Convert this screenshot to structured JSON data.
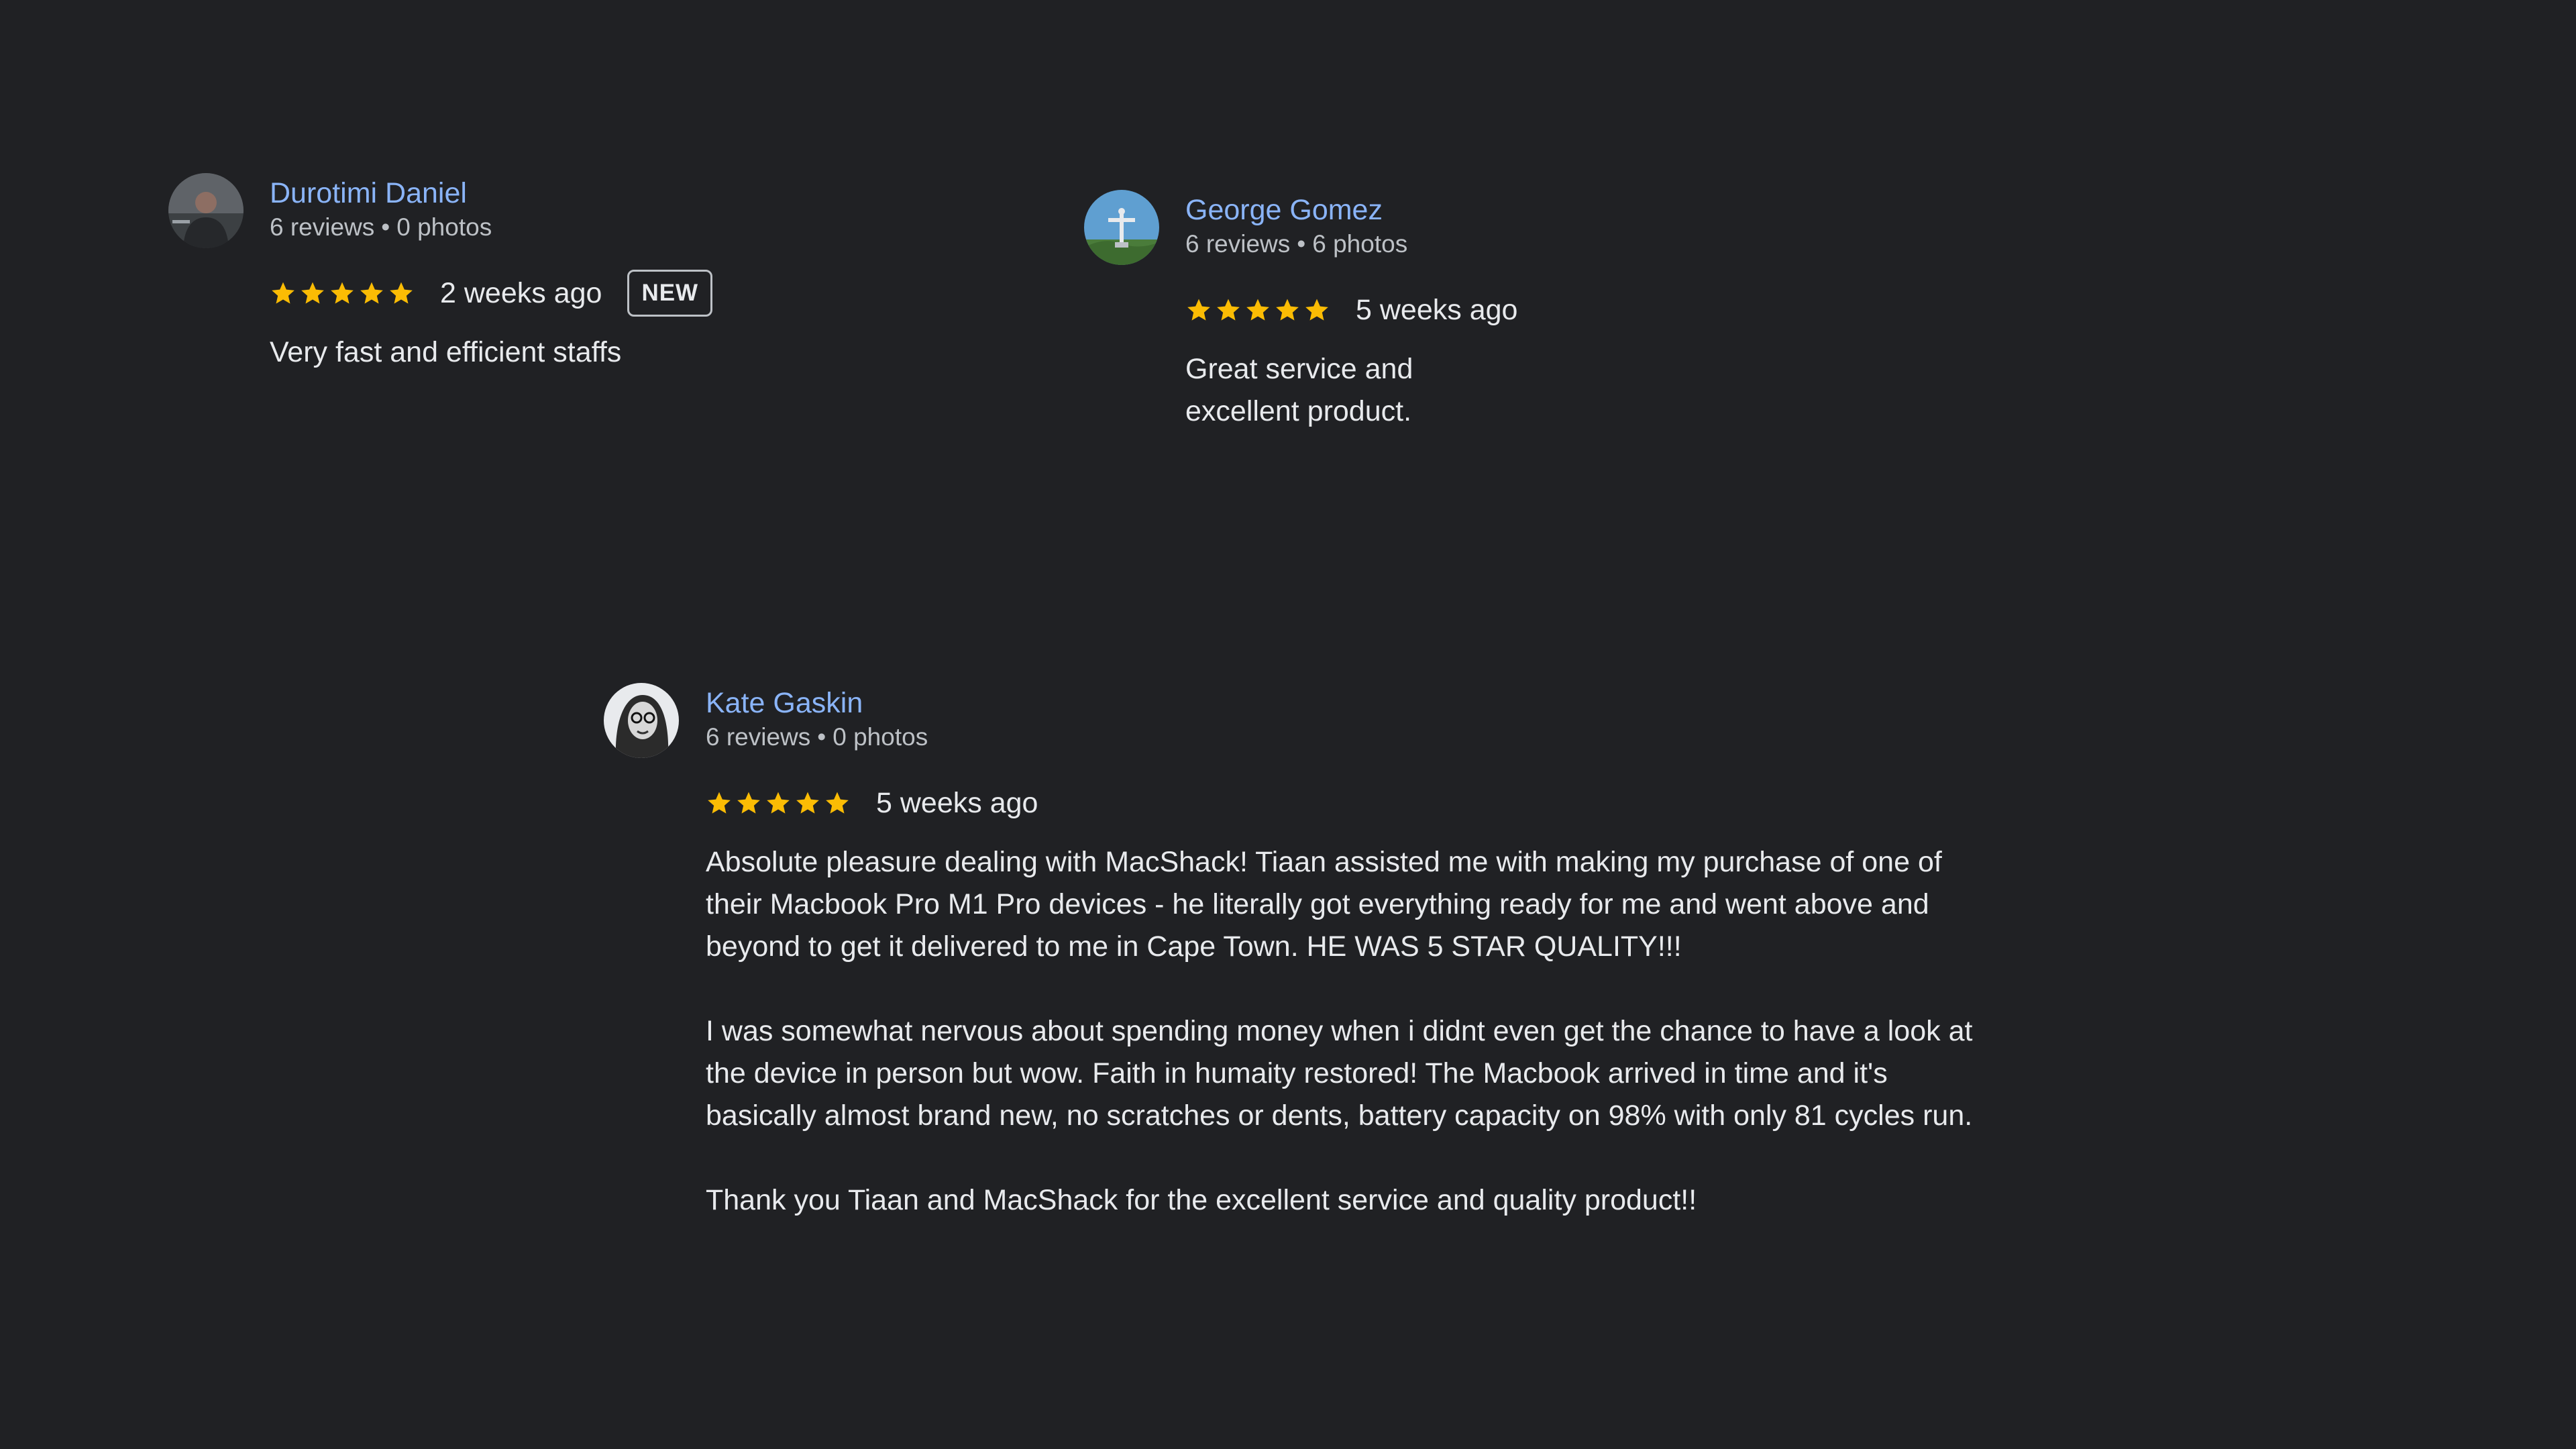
{
  "reviews": [
    {
      "name": "Durotimi Daniel",
      "reviews_count": "6 reviews",
      "separator": "•",
      "photos_count": "0 photos",
      "date": "2 weeks ago",
      "badge": "NEW",
      "rating": 5,
      "paragraphs": [
        "Very fast and efficient staffs"
      ]
    },
    {
      "name": "George Gomez",
      "reviews_count": "6 reviews",
      "separator": "•",
      "photos_count": "6 photos",
      "date": "5 weeks ago",
      "rating": 5,
      "paragraphs": [
        "Great service and excellent product."
      ]
    },
    {
      "name": "Kate Gaskin",
      "reviews_count": "6 reviews",
      "separator": "•",
      "photos_count": "0 photos",
      "date": "5 weeks ago",
      "rating": 5,
      "paragraphs": [
        "Absolute pleasure dealing with MacShack! Tiaan assisted me with making my purchase of one of their Macbook Pro M1 Pro devices - he literally got everything ready for me and went above and beyond to get it delivered to me in Cape Town. HE WAS 5 STAR QUALITY!!!",
        "I was somewhat nervous about spending money when i didnt even get the chance to have a look at the device in person but wow. Faith in humaity restored! The Macbook arrived in time and it's basically almost brand new, no scratches or dents, battery capacity on 98% with only 81 cycles run.",
        "Thank you Tiaan and MacShack for the excellent service and quality product!!"
      ]
    }
  ],
  "colors": {
    "background": "#202124",
    "name": "#8ab4f8",
    "star": "#fbbc04",
    "text": "#e8eaed",
    "meta": "#bdc1c6"
  },
  "icons": {
    "star": "star-icon",
    "avatar": "avatar-icon"
  }
}
